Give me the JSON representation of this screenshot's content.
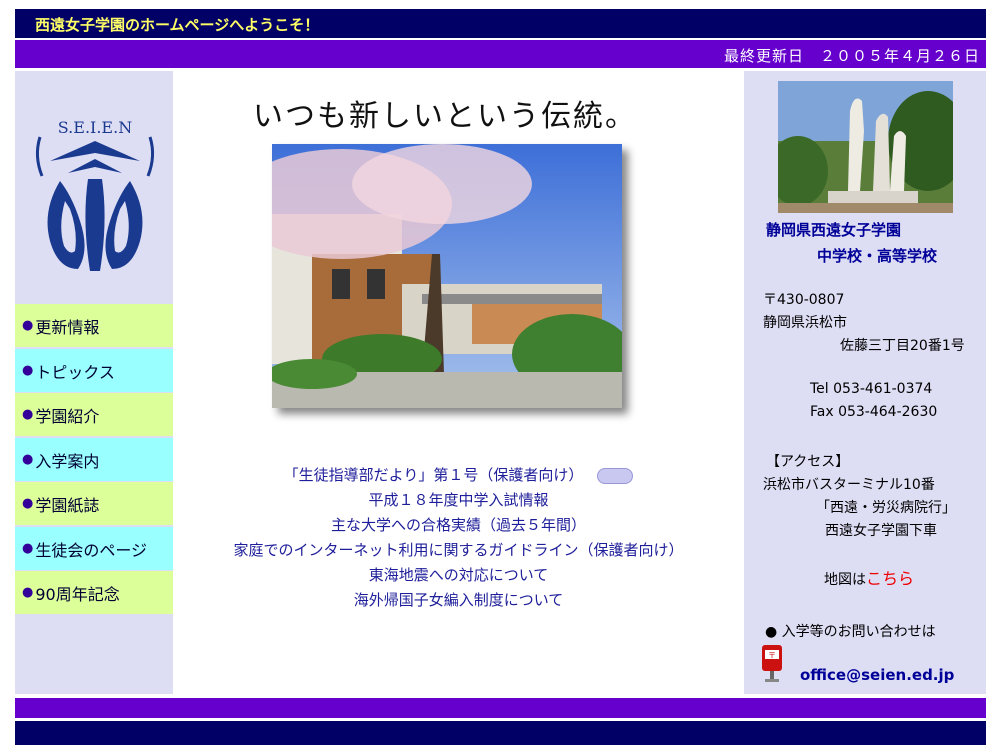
{
  "header": {
    "welcome": "西遠女子学園のホームページへようこそ！",
    "last_updated": "最終更新日　２００５年４月２６日"
  },
  "logo": {
    "text": "S.E.I.E.N"
  },
  "nav": {
    "bullet": "●",
    "items": [
      {
        "label": "更新情報"
      },
      {
        "label": "トピックス"
      },
      {
        "label": "学園紹介"
      },
      {
        "label": "入学案内"
      },
      {
        "label": "学園紙誌"
      },
      {
        "label": "生徒会のページ"
      },
      {
        "label": "90周年記念"
      }
    ]
  },
  "main": {
    "slogan": "いつも新しいという伝統。",
    "links": [
      {
        "label": "「生徒指導部だより」第１号（保護者向け）"
      },
      {
        "label": "平成１８年度中学入試情報"
      },
      {
        "label": "主な大学への合格実績（過去５年間）"
      },
      {
        "label": "家庭でのインターネット利用に関するガイドライン（保護者向け）"
      },
      {
        "label": "東海地震への対応について"
      },
      {
        "label": "海外帰国子女編入制度について"
      }
    ]
  },
  "sidebar": {
    "school_name_1": "静岡県西遠女子学園",
    "school_name_2": "中学校・高等学校",
    "postal": "〒430-0807",
    "address_1": "静岡県浜松市",
    "address_2": "佐藤三丁目20番1号",
    "tel": "Tel 053-461-0374",
    "fax": "Fax 053-464-2630",
    "access_title": "【アクセス】",
    "access_1": "浜松市バスターミナル10番",
    "access_2": "「西遠・労災病院行」",
    "access_3": "西遠女子学園下車",
    "map_prefix": "地図は",
    "map_link": "こちら",
    "inquiry": "● 入学等のお問い合わせは",
    "email": "office@seien.ed.jp"
  },
  "colors": {
    "navy": "#000066",
    "purple": "#6600cc",
    "lavender": "#ddddf4",
    "nav_green": "#ddff99",
    "nav_cyan": "#99ffff",
    "welcome_yellow": "#ffff66",
    "link_blue": "#1e1e9a",
    "map_red": "#ee0000"
  }
}
